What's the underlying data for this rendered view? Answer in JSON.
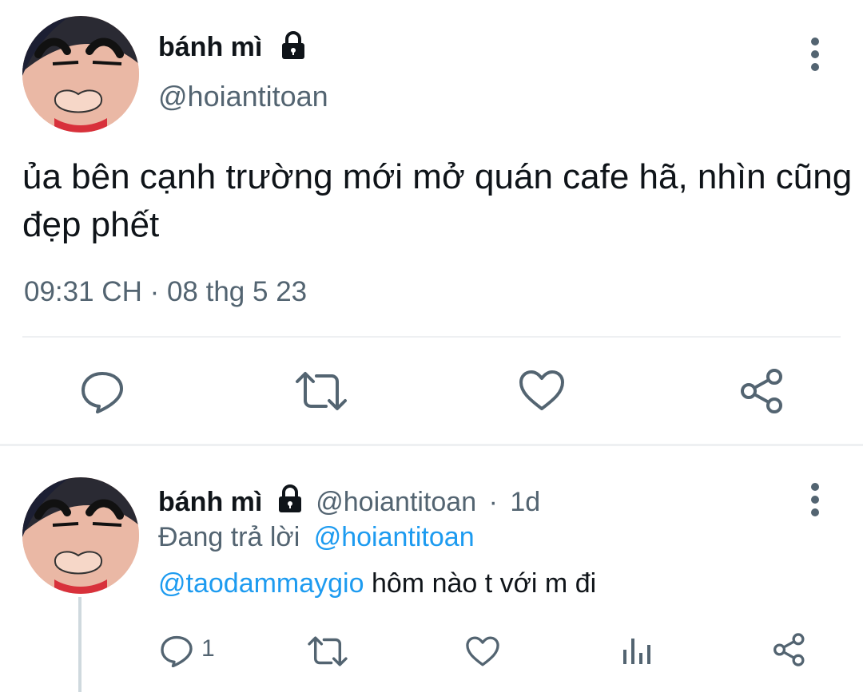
{
  "main_tweet": {
    "display_name": "bánh mì",
    "handle": "@hoiantitoan",
    "text": "ủa bên cạnh trường mới mở quán cafe hã, nhìn cũng đẹp phết",
    "timestamp": "09:31 CH · 08 thg 5 23",
    "icons": {
      "more": "more-vertical-icon",
      "lock": "lock-icon",
      "reply": "reply-icon",
      "retweet": "retweet-icon",
      "like": "heart-icon",
      "share": "share-icon"
    }
  },
  "reply_tweet": {
    "display_name": "bánh mì",
    "handle": "@hoiantitoan",
    "separator": "·",
    "age": "1d",
    "replying_to_prefix": "Đang trả lời",
    "replying_to_handle": "@hoiantitoan",
    "mention": "@taodammaygio",
    "text": " hôm nào t với m đi",
    "reply_count": "1",
    "icons": {
      "more": "more-vertical-icon",
      "lock": "lock-icon",
      "reply": "reply-icon",
      "retweet": "retweet-icon",
      "like": "heart-icon",
      "analytics": "analytics-icon",
      "share": "share-icon"
    }
  },
  "colors": {
    "accent": "#1d9bf0",
    "secondary_text": "#536471",
    "primary_text": "#0f1419",
    "divider": "#eef0f2"
  }
}
